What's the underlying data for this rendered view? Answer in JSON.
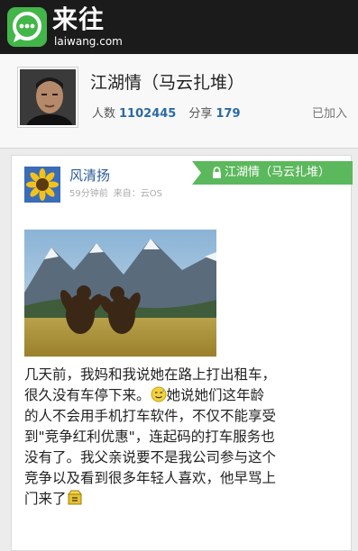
{
  "app": {
    "logo_text": "来往",
    "logo_sub": "laiwang.com"
  },
  "group": {
    "name": "江湖情（马云扎堆）",
    "members_label": "人数",
    "members": "1102445",
    "shares_label": "分享",
    "shares": "179",
    "status": "已加入"
  },
  "post": {
    "author": "风清扬",
    "time": "59分钟前",
    "source": "来自：云OS",
    "group_tag": "江湖情（马云扎堆）",
    "text_lines": [
      "几天前，我妈和我说她在路上打出租车，",
      "很久没有车停下来。",
      "她说她们这年龄",
      "的人不会用手机打车软件，不仅不能享受",
      "到\"竞争红利优惠\"，连起码的打车服务也",
      "没有了。我父亲说要不是我公司参与这个",
      "竞争以及看到很多年轻人喜欢，他早骂上",
      "门来了"
    ]
  },
  "colors": {
    "topbar": "#1b1b1b",
    "brand_green": "#43b649",
    "tag_green": "#5cb85c",
    "link_blue": "#2b5a9a",
    "number_blue": "#2b6aa6"
  },
  "icons": {
    "logo": "chat-bubble-icon",
    "tag": "lock-icon",
    "emoji_1": "sweat-smile-emoji-icon",
    "emoji_2": "box-emoji-icon"
  }
}
